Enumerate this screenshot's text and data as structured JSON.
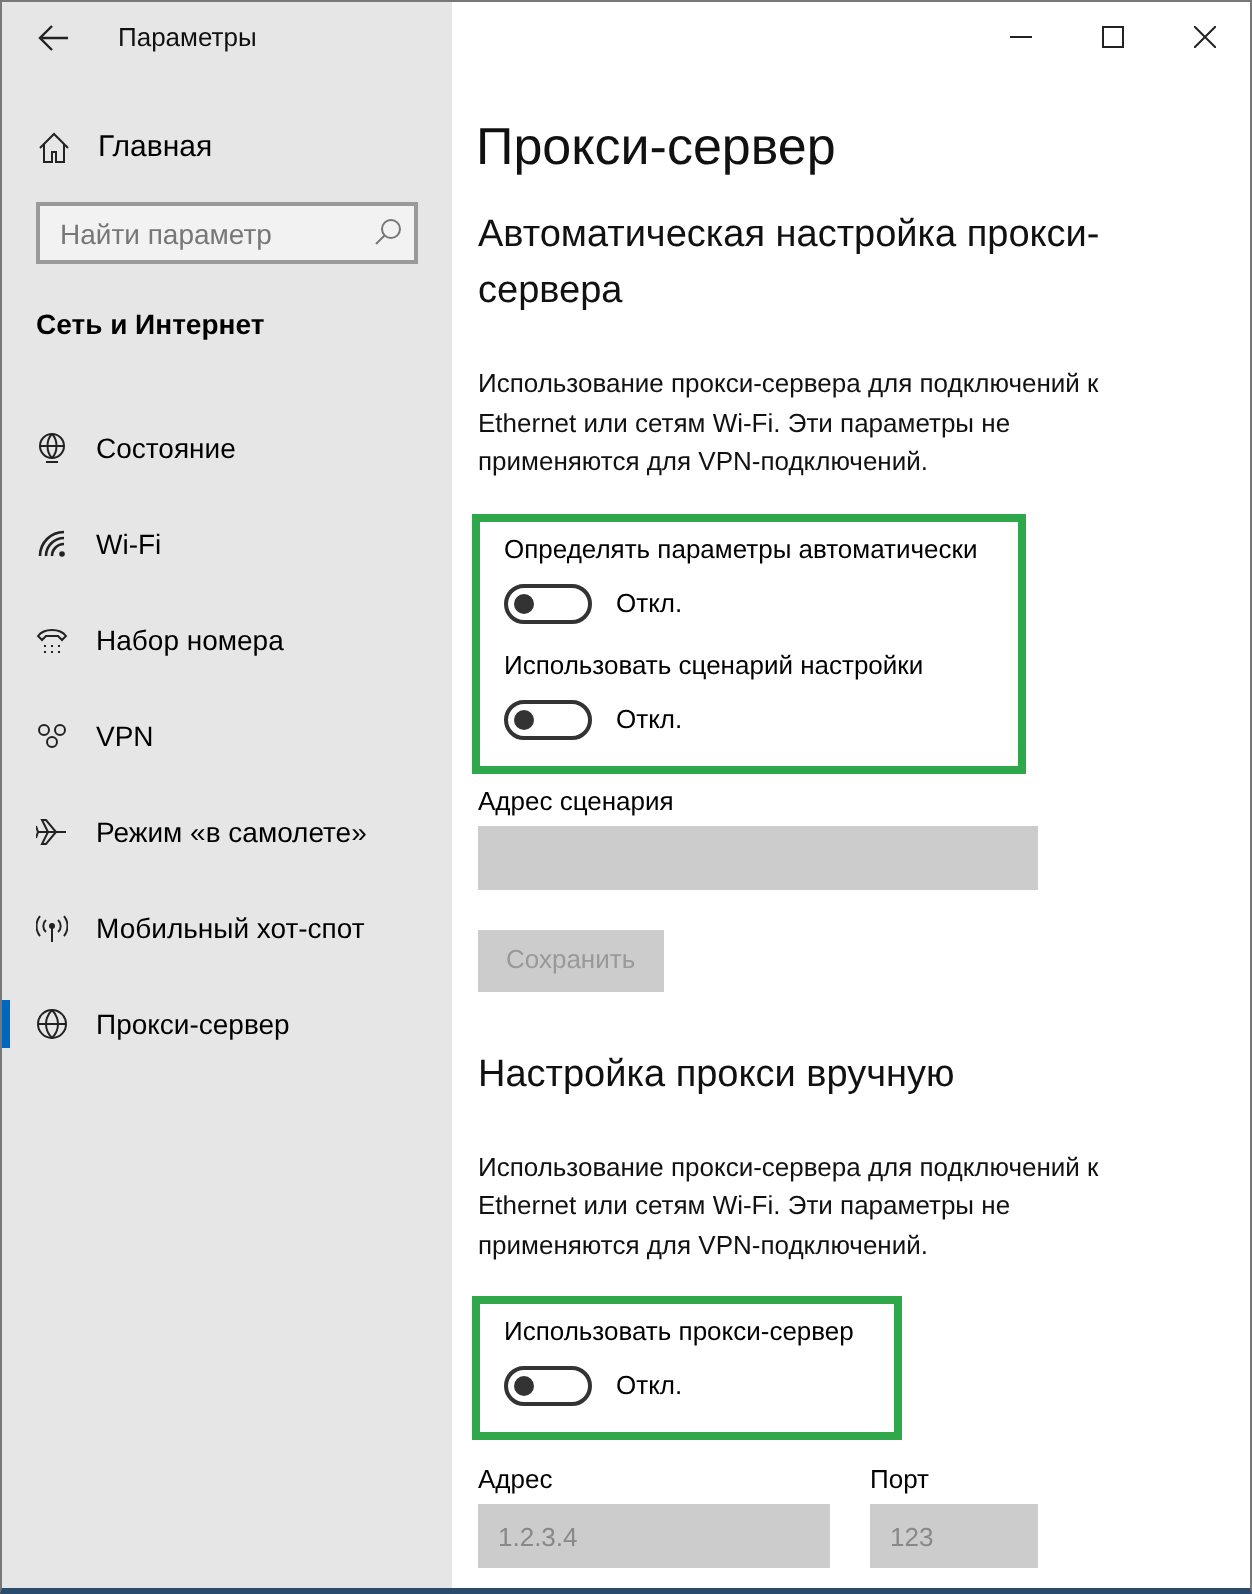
{
  "window": {
    "title": "Параметры"
  },
  "sidebar": {
    "home": "Главная",
    "search": {
      "placeholder": "Найти параметр"
    },
    "section_title": "Сеть и Интернет",
    "items": [
      {
        "label": "Состояние",
        "selected": false
      },
      {
        "label": "Wi-Fi",
        "selected": false
      },
      {
        "label": "Набор номера",
        "selected": false
      },
      {
        "label": "VPN",
        "selected": false
      },
      {
        "label": "Режим «в самолете»",
        "selected": false
      },
      {
        "label": "Мобильный хот-спот",
        "selected": false
      },
      {
        "label": "Прокси-сервер",
        "selected": true
      }
    ]
  },
  "page_title": "Прокси-сервер",
  "sections": [
    {
      "heading": "Автоматическая настройка прокси-сервера",
      "description": "Использование прокси-сервера для подключений к Ethernet или сетям Wi-Fi. Эти параметры не применяются для VPN-подключений.",
      "toggle_group": {
        "highlighted": true,
        "toggles": [
          {
            "label": "Определять параметры автоматически",
            "on": false,
            "state_text": "Откл."
          },
          {
            "label": "Использовать сценарий настройки",
            "on": false,
            "state_text": "Откл."
          }
        ]
      },
      "fields": [
        {
          "label": "Адрес сценария",
          "disabled": true
        }
      ],
      "button": {
        "label": "Сохранить",
        "disabled": true
      }
    },
    {
      "heading": "Настройка прокси вручную",
      "description": "Использование прокси-сервера для подключений к Ethernet или сетям Wi-Fi. Эти параметры не применяются для VPN-подключений.",
      "toggle_group": {
        "highlighted": true,
        "toggles": [
          {
            "label": "Использовать прокси-сервер",
            "on": false,
            "state_text": "Откл."
          }
        ]
      },
      "fields": [
        {
          "label": "Адрес",
          "value": "1.2.3.4",
          "disabled": true
        },
        {
          "label": "Порт",
          "value": "123",
          "disabled": true
        }
      ]
    }
  ]
}
